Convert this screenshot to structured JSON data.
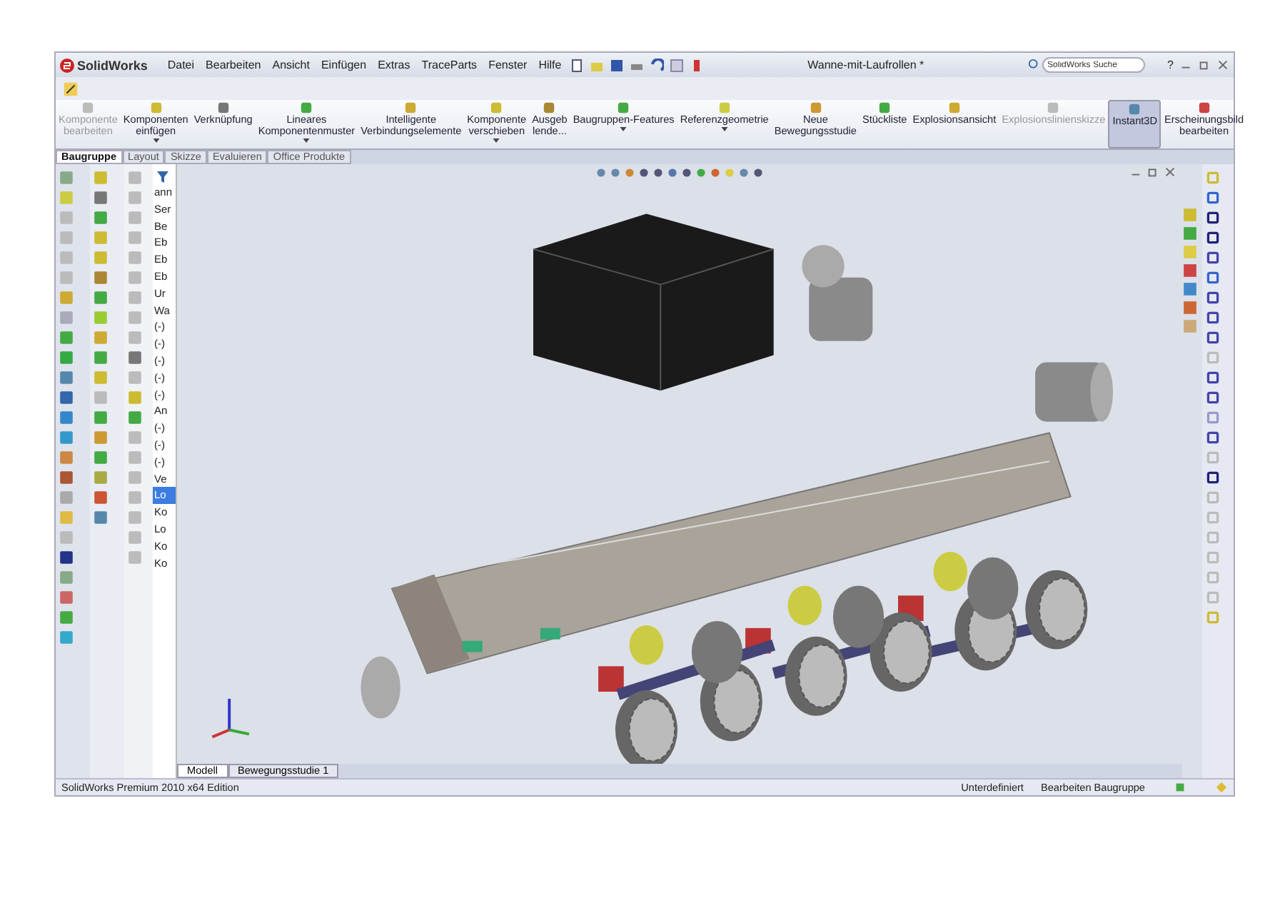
{
  "menu_bar": {
    "logo": "SolidWorks",
    "menus": [
      "Datei",
      "Bearbeiten",
      "Ansicht",
      "Einfügen",
      "Extras",
      "TraceParts",
      "Fenster",
      "Hilfe"
    ],
    "document_title": "Wanne-mit-Laufrollen *",
    "search": {
      "placeholder": "SolidWorks Suche"
    },
    "help": "?"
  },
  "ribbon": [
    {
      "lines": [
        "Komponente",
        "bearbeiten"
      ],
      "disabled": true,
      "selected": false,
      "dropdown": false
    },
    {
      "lines": [
        "Komponenten",
        "einfügen"
      ],
      "disabled": false,
      "selected": false,
      "dropdown": true
    },
    {
      "lines": [
        "Verknüpfung"
      ],
      "disabled": false,
      "selected": false,
      "dropdown": false
    },
    {
      "lines": [
        "Lineares",
        "Komponentenmuster"
      ],
      "disabled": false,
      "selected": false,
      "dropdown": true
    },
    {
      "lines": [
        "Intelligente",
        "Verbindungselemente"
      ],
      "disabled": false,
      "selected": false,
      "dropdown": false
    },
    {
      "lines": [
        "Komponente",
        "verschieben"
      ],
      "disabled": false,
      "selected": false,
      "dropdown": true
    },
    {
      "lines": [
        "Ausgeb",
        "lende..."
      ],
      "disabled": false,
      "selected": false,
      "dropdown": false
    },
    {
      "lines": [
        "Baugruppen-Features"
      ],
      "disabled": false,
      "selected": false,
      "dropdown": true
    },
    {
      "lines": [
        "Referenzgeometrie"
      ],
      "disabled": false,
      "selected": false,
      "dropdown": true
    },
    {
      "lines": [
        "Neue",
        "Bewegungsstudie"
      ],
      "disabled": false,
      "selected": false,
      "dropdown": false
    },
    {
      "lines": [
        "Stückliste"
      ],
      "disabled": false,
      "selected": false,
      "dropdown": false
    },
    {
      "lines": [
        "Explosionsansicht"
      ],
      "disabled": false,
      "selected": false,
      "dropdown": false
    },
    {
      "lines": [
        "Explosionslinienskizze"
      ],
      "disabled": true,
      "selected": false,
      "dropdown": false
    },
    {
      "lines": [
        "Instant3D"
      ],
      "disabled": false,
      "selected": true,
      "dropdown": false
    },
    {
      "lines": [
        "Erscheinungsbild",
        "bearbeiten"
      ],
      "disabled": false,
      "selected": false,
      "dropdown": false
    }
  ],
  "tabs": [
    {
      "label": "Baugruppe",
      "selected": true
    },
    {
      "label": "Layout",
      "selected": false
    },
    {
      "label": "Skizze",
      "selected": false
    },
    {
      "label": "Evaluieren",
      "selected": false
    },
    {
      "label": "Office Produkte",
      "selected": false
    }
  ],
  "feature_tree": [
    {
      "label": "ann",
      "selected": false
    },
    {
      "label": "Ser",
      "selected": false
    },
    {
      "label": "Be",
      "selected": false
    },
    {
      "label": "Eb",
      "selected": false
    },
    {
      "label": "Eb",
      "selected": false
    },
    {
      "label": "Eb",
      "selected": false
    },
    {
      "label": "Ur",
      "selected": false
    },
    {
      "label": "Wa",
      "selected": false
    },
    {
      "label": "(-)",
      "selected": false
    },
    {
      "label": "(-)",
      "selected": false
    },
    {
      "label": "(-)",
      "selected": false
    },
    {
      "label": "(-)",
      "selected": false
    },
    {
      "label": "(-)",
      "selected": false
    },
    {
      "label": "An",
      "selected": false
    },
    {
      "label": "(-)",
      "selected": false
    },
    {
      "label": "(-)",
      "selected": false
    },
    {
      "label": "(-)",
      "selected": false
    },
    {
      "label": "Ve",
      "selected": false
    },
    {
      "label": "Lo",
      "selected": true
    },
    {
      "label": "Ko",
      "selected": false
    },
    {
      "label": "Lo",
      "selected": false
    },
    {
      "label": "Ko",
      "selected": false
    },
    {
      "label": "Ko",
      "selected": false
    }
  ],
  "motion_tabs": [
    {
      "label": "Modell",
      "selected": true
    },
    {
      "label": "Bewegungsstudie 1",
      "selected": false
    }
  ],
  "status_bar": {
    "edition": "SolidWorks Premium 2010 x64 Edition",
    "state": "Unterdefiniert",
    "mode": "Bearbeiten Baugruppe"
  }
}
